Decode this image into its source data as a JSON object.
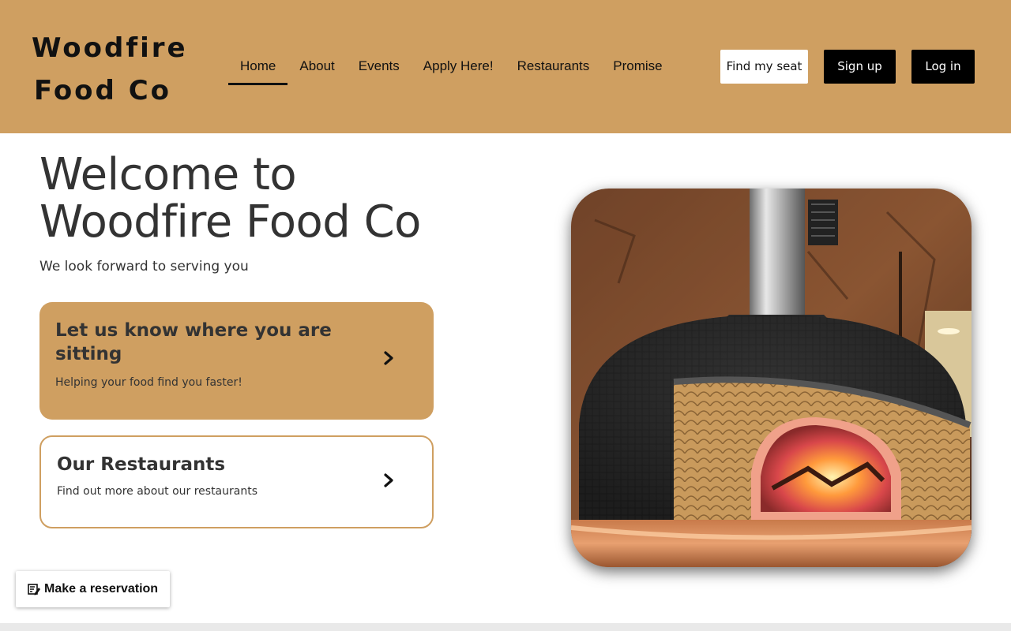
{
  "header": {
    "logo_line1": "Woodfire",
    "logo_line2": "Food Co",
    "nav": [
      "Home",
      "About",
      "Events",
      "Apply Here!",
      "Restaurants",
      "Promise"
    ],
    "active_nav": "Home",
    "find_seat": "Find my seat",
    "sign_up": "Sign up",
    "log_in": "Log in"
  },
  "hero": {
    "title_line1": "Welcome to",
    "title_line2": "Woodfire Food Co",
    "subtitle": "We look forward to serving you"
  },
  "cards": {
    "seat": {
      "title": "Let us know where you are sitting",
      "description": "Helping your food find you faster!",
      "icon": "chevron-right-icon"
    },
    "restaurants": {
      "title": "Our Restaurants",
      "description": "Find out more about our restaurants",
      "icon": "chevron-right-icon"
    }
  },
  "image": {
    "subject": "wood-fired pizza oven"
  },
  "reservation": {
    "label": "Make a reservation",
    "icon": "edit-note-icon"
  },
  "colors": {
    "brand": "#cf9f61",
    "dark": "#000000",
    "text": "#333333"
  }
}
